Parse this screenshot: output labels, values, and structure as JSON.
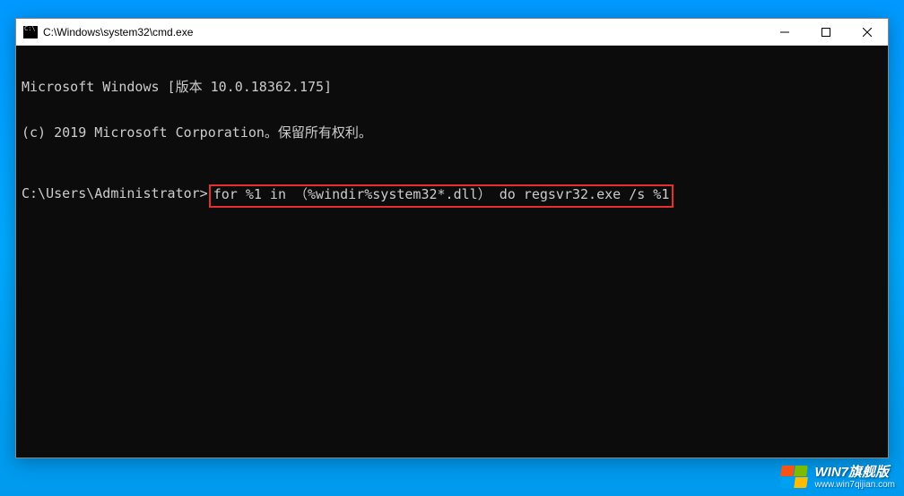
{
  "window": {
    "title": "C:\\Windows\\system32\\cmd.exe"
  },
  "terminal": {
    "line1": "Microsoft Windows [版本 10.0.18362.175]",
    "line2": "(c) 2019 Microsoft Corporation。保留所有权利。",
    "prompt": "C:\\Users\\Administrator>",
    "command": "for %1 in （%windir%system32*.dll） do regsvr32.exe /s %1"
  },
  "watermark": {
    "brand": "WIN7旗舰版",
    "url": "www.win7qijian.com"
  }
}
